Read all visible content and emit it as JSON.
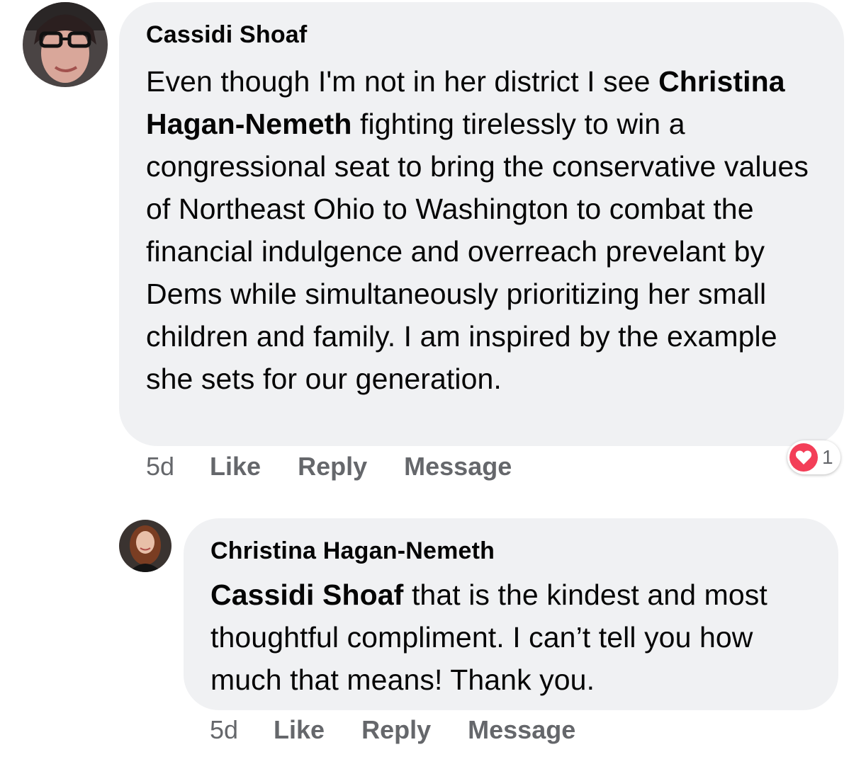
{
  "comments": [
    {
      "author": "Cassidi Shoaf",
      "text_before": "Even though I'm not in her district I see",
      "mention": "Christina Hagan-Nemeth",
      "text_after": "fighting tirelessly to win a congressional seat to bring the conservative values of Northeast Ohio to Washington to combat the financial indulgence and overreach prevelant by Dems while simultaneously prioritizing her small children and family. I am inspired by the example she sets for our generation.",
      "time": "5d",
      "like_label": "Like",
      "reply_label": "Reply",
      "message_label": "Message",
      "reaction": {
        "icon": "heart-icon",
        "count": "1",
        "color": "#f33e58"
      }
    },
    {
      "author": "Christina Hagan-Nemeth",
      "mention": "Cassidi Shoaf",
      "text_after": "that is the kindest and most thoughtful compliment. I can’t tell you how much that means! Thank you.",
      "time": "5d",
      "like_label": "Like",
      "reply_label": "Reply",
      "message_label": "Message"
    }
  ],
  "colors": {
    "bubble": "#f0f1f3",
    "text": "#050505",
    "secondary": "#65676b",
    "reaction_heart": "#f33e58"
  }
}
